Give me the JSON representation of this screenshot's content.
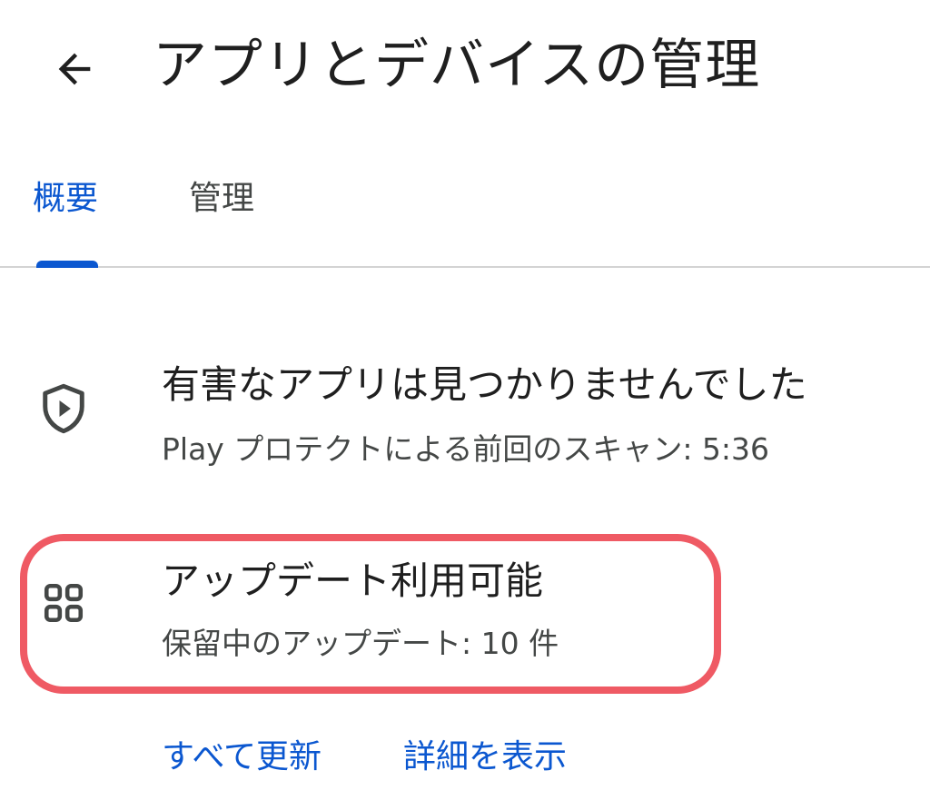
{
  "header": {
    "back_icon": "arrow-back-icon",
    "title": "アプリとデバイスの管理"
  },
  "tabs": [
    {
      "label": "概要",
      "active": true
    },
    {
      "label": "管理",
      "active": false
    }
  ],
  "protect": {
    "icon": "shield-play-icon",
    "title": "有害なアプリは見つかりませんでした",
    "subtitle": "Play プロテクトによる前回のスキャン: 5:36"
  },
  "updates": {
    "icon": "apps-grid-icon",
    "title": "アップデート利用可能",
    "subtitle": "保留中のアップデート: 10 件",
    "highlight_color": "#ef5a64"
  },
  "actions": {
    "update_all": "すべて更新",
    "see_details": "詳細を表示"
  },
  "colors": {
    "accent": "#0b57d0",
    "text_primary": "#1f1f1f",
    "text_secondary": "#444746"
  }
}
